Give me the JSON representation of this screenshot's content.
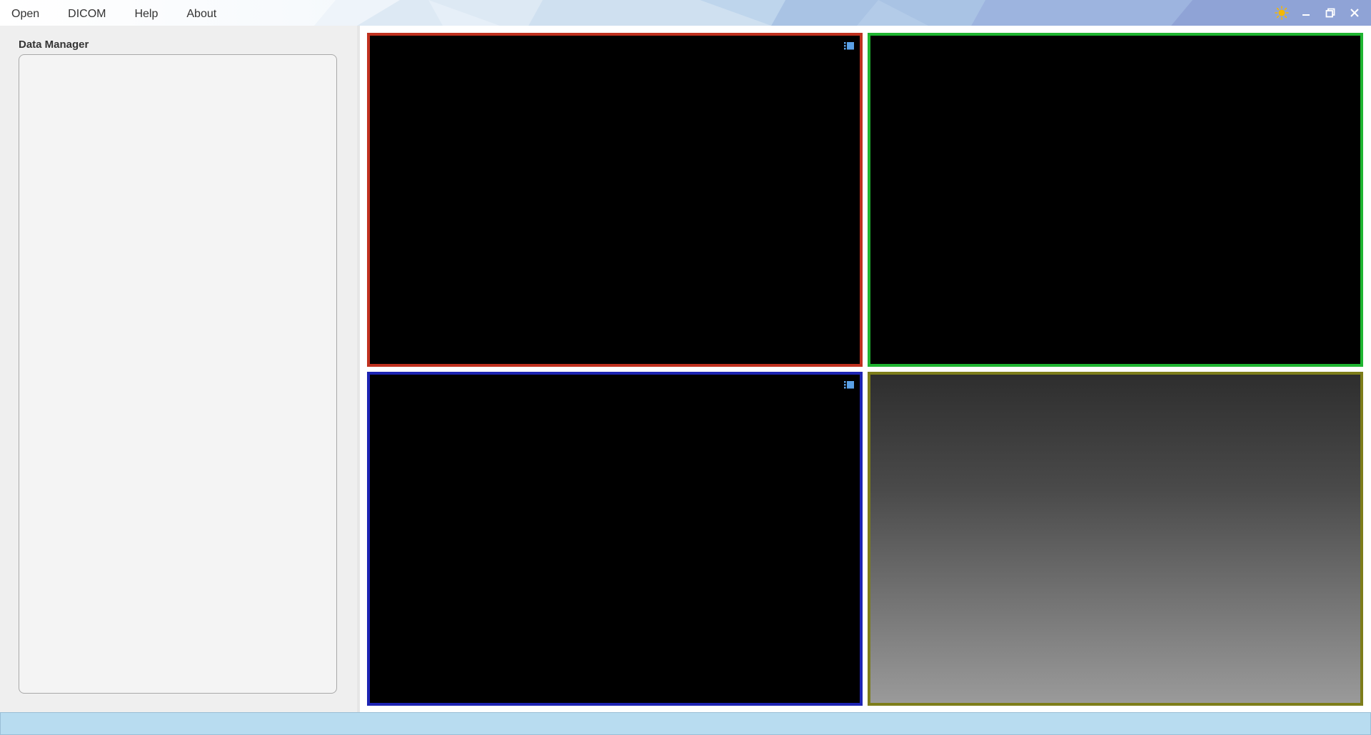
{
  "menu": {
    "items": [
      "Open",
      "DICOM",
      "Help",
      "About"
    ]
  },
  "window_controls": {
    "theme_icon": "sun-icon",
    "minimize_icon": "minimize-icon",
    "restore_icon": "restore-icon",
    "close_icon": "close-icon"
  },
  "data_manager": {
    "title": "Data Manager"
  },
  "viewports": [
    {
      "name": "viewport-red",
      "border_color": "#c0311f",
      "has_menu_icon": true
    },
    {
      "name": "viewport-green",
      "border_color": "#1fb531",
      "has_menu_icon": false
    },
    {
      "name": "viewport-blue",
      "border_color": "#1d24b3",
      "has_menu_icon": true
    },
    {
      "name": "viewport-3d",
      "border_color": "#7d7d1a",
      "has_menu_icon": false
    }
  ],
  "colors": {
    "statusbar": "#b8dcf0",
    "sun": "#f5b800",
    "viewport_icon": "#5aa0e6"
  }
}
